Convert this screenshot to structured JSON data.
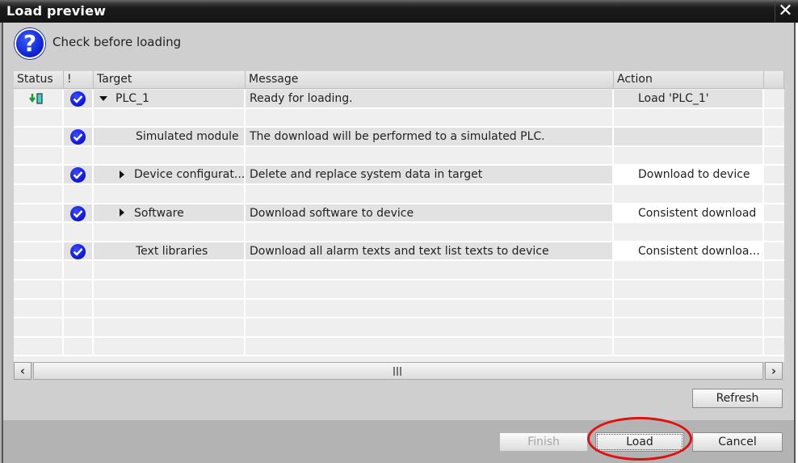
{
  "window": {
    "title": "Load preview",
    "close_label": "✕"
  },
  "header": {
    "icon": "question-icon",
    "icon_glyph": "?",
    "text": "Check before loading"
  },
  "table": {
    "columns": [
      "Status",
      "!",
      "Target",
      "Message",
      "Action"
    ],
    "rows": [
      {
        "status_icon": "download-to-device-icon",
        "check": true,
        "expander": "expanded",
        "target": "PLC_1",
        "message": "Ready for loading.",
        "action": "Load 'PLC_1'"
      },
      {
        "status_icon": "",
        "check": true,
        "expander": "none",
        "target": "Simulated module",
        "message": "The download will be performed to a simulated PLC.",
        "action": ""
      },
      {
        "status_icon": "",
        "check": true,
        "expander": "collapsed",
        "target": "Device configurat...",
        "message": "Delete and replace system data in target",
        "action": "Download to device"
      },
      {
        "status_icon": "",
        "check": true,
        "expander": "collapsed",
        "target": "Software",
        "message": "Download software to device",
        "action": "Consistent download"
      },
      {
        "status_icon": "",
        "check": true,
        "expander": "none",
        "target": "Text libraries",
        "message": "Download all alarm texts and text list texts to device",
        "action": "Consistent downloa..."
      }
    ]
  },
  "buttons": {
    "refresh": "Refresh",
    "finish": "Finish",
    "load": "Load",
    "cancel": "Cancel"
  },
  "colors": {
    "check_blue": "#0a14d6",
    "annotation_red": "#e01010",
    "status_green": "#1a9a3a"
  }
}
